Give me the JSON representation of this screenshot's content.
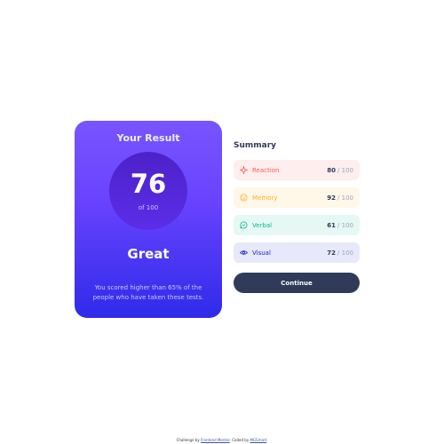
{
  "result": {
    "title": "Your Result",
    "score": "76",
    "out_of": "of 100",
    "grade": "Great",
    "message": "You scored higher than 65% of the people who have taken these tests."
  },
  "summary": {
    "title": "Summary",
    "items": [
      {
        "label": "Reaction",
        "score": "80",
        "total": "/ 100",
        "icon": "lightning-icon",
        "color": "#ff5757"
      },
      {
        "label": "Memory",
        "score": "92",
        "total": "/ 100",
        "icon": "brain-icon",
        "color": "#ffb01f"
      },
      {
        "label": "Verbal",
        "score": "61",
        "total": "/ 100",
        "icon": "chat-bubble-icon",
        "color": "#00bb8f"
      },
      {
        "label": "Visual",
        "score": "72",
        "total": "/ 100",
        "icon": "eye-icon",
        "color": "#1125d4"
      }
    ],
    "continue_label": "Continue"
  },
  "attribution": {
    "prefix": "Challenge by",
    "link1": "Frontend Mentor",
    "middle": ". Coded by",
    "link2": "MGSmart",
    "suffix": "."
  },
  "colors": {
    "dark_navy": "#303b5a",
    "gradient_start": "#7755ff",
    "gradient_end": "#2f2be9"
  }
}
